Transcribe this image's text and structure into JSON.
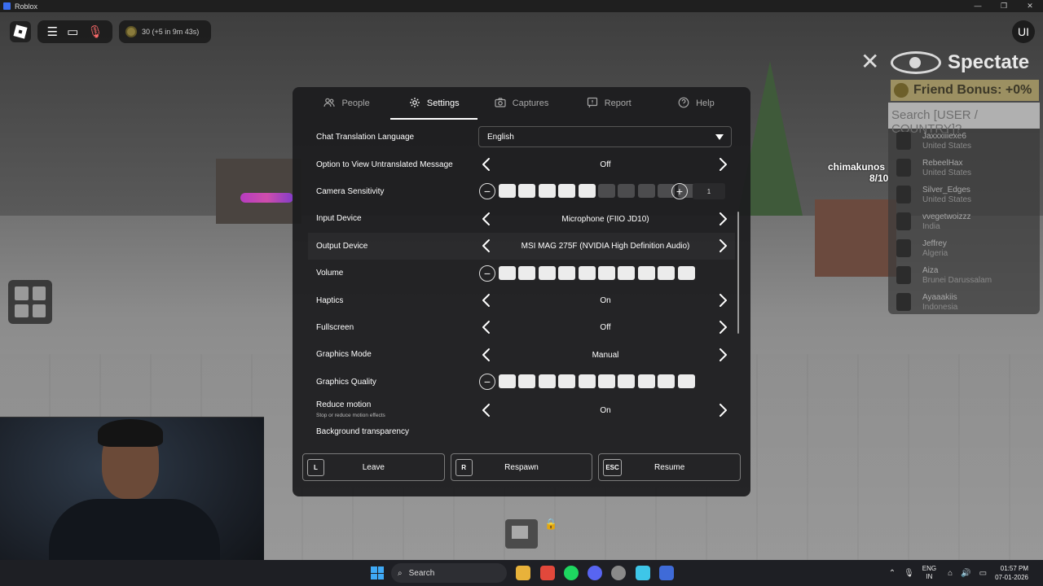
{
  "window": {
    "title": "Roblox",
    "controls": [
      "—",
      "❐",
      "✕"
    ]
  },
  "hud": {
    "coins_text": "30 (+5 in 9m 43s)",
    "ui_button": "UI"
  },
  "spectate": {
    "title": "Spectate",
    "friend_bonus": "Friend Bonus: +0%",
    "search_placeholder": "Search [USER / COUNTRY]?",
    "players": [
      {
        "name": "Jaxxxiiiexe6",
        "country": "United States"
      },
      {
        "name": "RebeelHax",
        "country": "United States"
      },
      {
        "name": "Silver_Edges",
        "country": "United States"
      },
      {
        "name": "vvegetwoizzz",
        "country": "India"
      },
      {
        "name": "Jeffrey",
        "country": "Algeria"
      },
      {
        "name": "Aiza",
        "country": "Brunei Darussalam"
      },
      {
        "name": "Ayaaakiis",
        "country": "Indonesia"
      }
    ]
  },
  "nametag": {
    "name": "chimakunos",
    "sub": "8/10"
  },
  "tabs": [
    {
      "label": "People",
      "icon": "people-icon",
      "active": false
    },
    {
      "label": "Settings",
      "icon": "gear-icon",
      "active": true
    },
    {
      "label": "Captures",
      "icon": "camera-icon",
      "active": false
    },
    {
      "label": "Report",
      "icon": "flag-icon",
      "active": false
    },
    {
      "label": "Help",
      "icon": "help-icon",
      "active": false
    }
  ],
  "settings": {
    "chat_translation": {
      "label": "Chat Translation Language",
      "value": "English"
    },
    "untranslated": {
      "label": "Option to View Untranslated Message",
      "value": "Off"
    },
    "camera_sensitivity": {
      "label": "Camera Sensitivity",
      "level": 5,
      "max": 10,
      "value": "1"
    },
    "input_device": {
      "label": "Input Device",
      "value": "Microphone (FIIO JD10)"
    },
    "output_device": {
      "label": "Output Device",
      "value": "MSI MAG 275F (NVIDIA High Definition Audio)"
    },
    "volume": {
      "label": "Volume",
      "level": 10,
      "max": 10
    },
    "haptics": {
      "label": "Haptics",
      "value": "On"
    },
    "fullscreen": {
      "label": "Fullscreen",
      "value": "Off"
    },
    "graphics_mode": {
      "label": "Graphics Mode",
      "value": "Manual"
    },
    "graphics_quality": {
      "label": "Graphics Quality",
      "level": 10,
      "max": 10
    },
    "reduce_motion": {
      "label": "Reduce motion",
      "sublabel": "Stop or reduce motion effects",
      "value": "On"
    },
    "background_transparency": {
      "label": "Background transparency"
    }
  },
  "bottom_buttons": [
    {
      "key": "L",
      "label": "Leave"
    },
    {
      "key": "R",
      "label": "Respawn"
    },
    {
      "key": "ESC",
      "label": "Resume"
    }
  ],
  "taskbar": {
    "search_label": "Search",
    "lang_top": "ENG",
    "lang_bottom": "IN",
    "time": "01:57 PM",
    "date": "07-01-2026"
  },
  "colors": {
    "modal_bg": "#1c1c1e",
    "segment_on": "#ececec",
    "segment_off": "#4c4c4e",
    "friend_bonus_bg": "#9c9062"
  }
}
